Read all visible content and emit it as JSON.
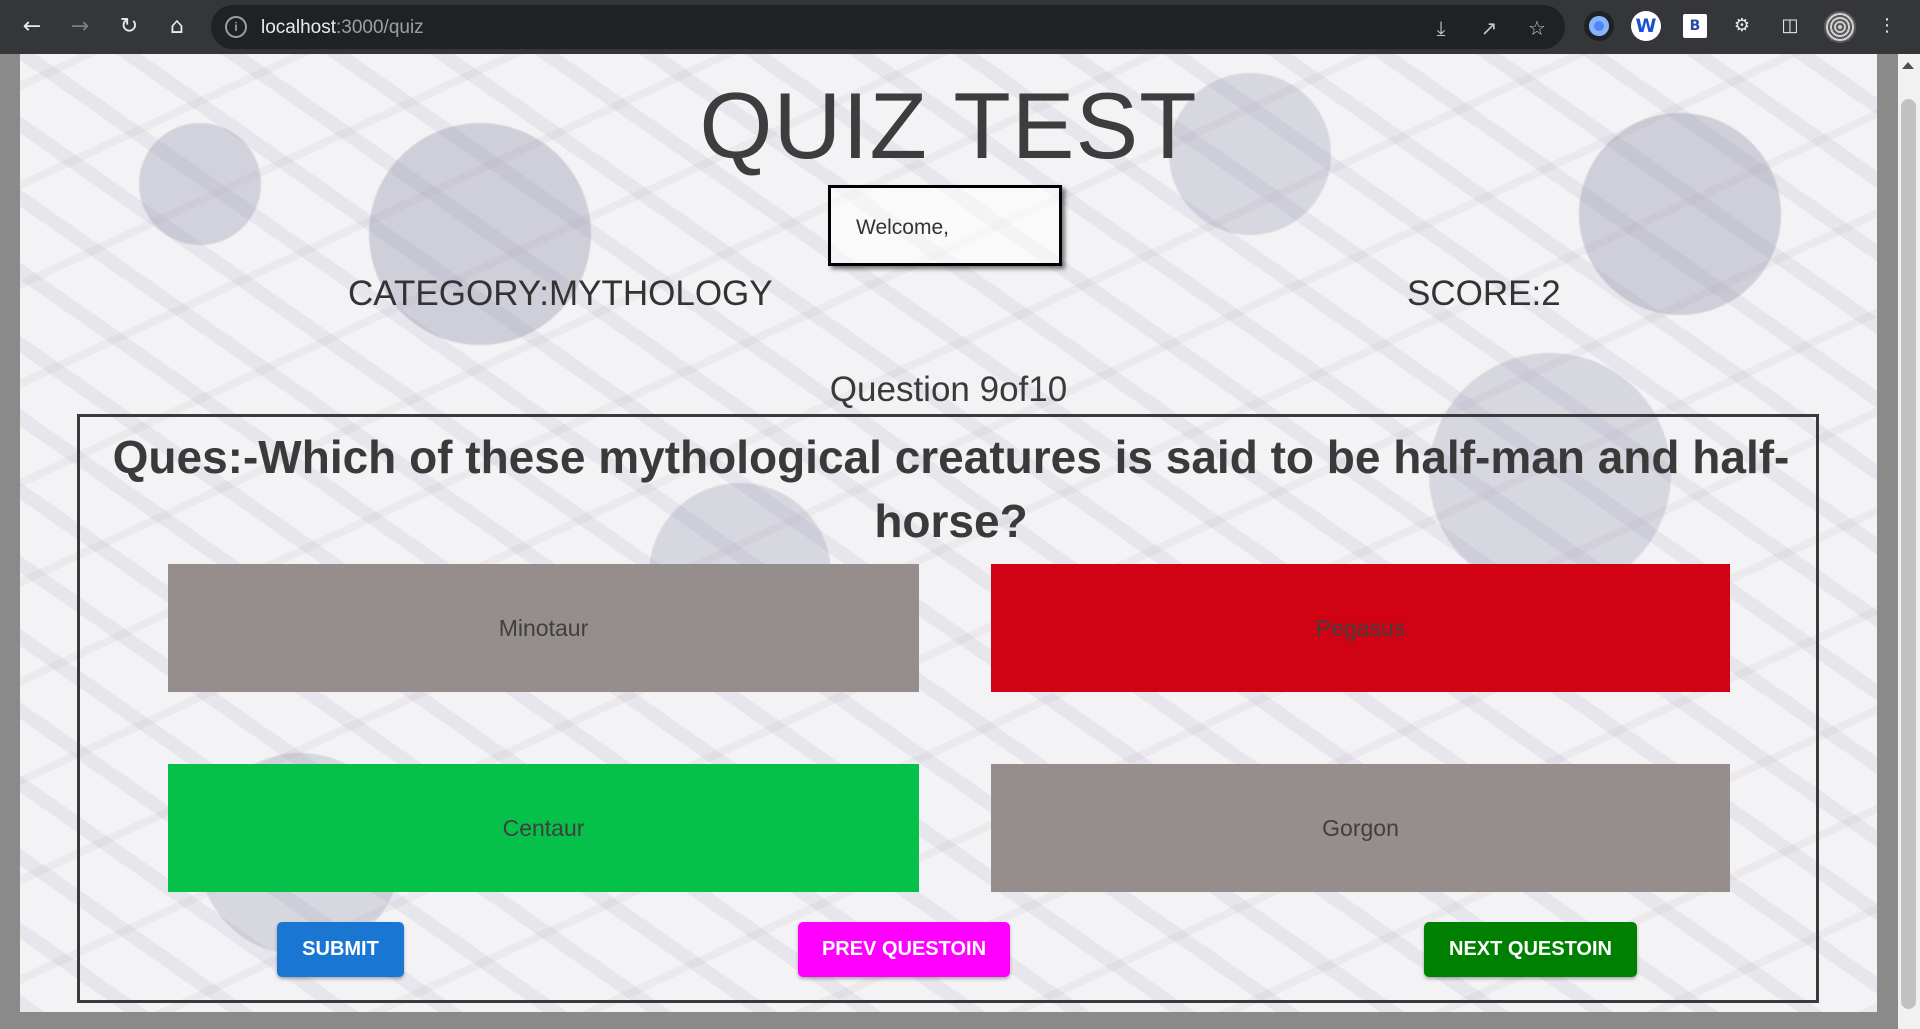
{
  "browser": {
    "url_host": "localhost",
    "url_path": ":3000/quiz",
    "ext_w": "W",
    "ext_b": "B"
  },
  "quiz": {
    "title": "QUIZ TEST",
    "welcome": "Welcome,",
    "category": "CATEGORY:MYTHOLOGY",
    "score": "SCORE:2",
    "question_counter": "Question 9of10",
    "question": "Ques:-Which of these mythological creatures is said to be half-man and half-horse?",
    "options": [
      {
        "label": "Minotaur",
        "state": "neutral",
        "color": "#968d8d"
      },
      {
        "label": "Pegasus",
        "state": "wrong",
        "color": "#d10214"
      },
      {
        "label": "Centaur",
        "state": "correct",
        "color": "#05c149"
      },
      {
        "label": "Gorgon",
        "state": "neutral",
        "color": "#968d8d"
      }
    ],
    "buttons": {
      "submit": {
        "label": "SUBMIT",
        "color": "#1976d2"
      },
      "prev": {
        "label": "PREV QUESTOIN",
        "color": "#ff00ff"
      },
      "next": {
        "label": "NEXT QUESTOIN",
        "color": "#008000"
      }
    }
  }
}
